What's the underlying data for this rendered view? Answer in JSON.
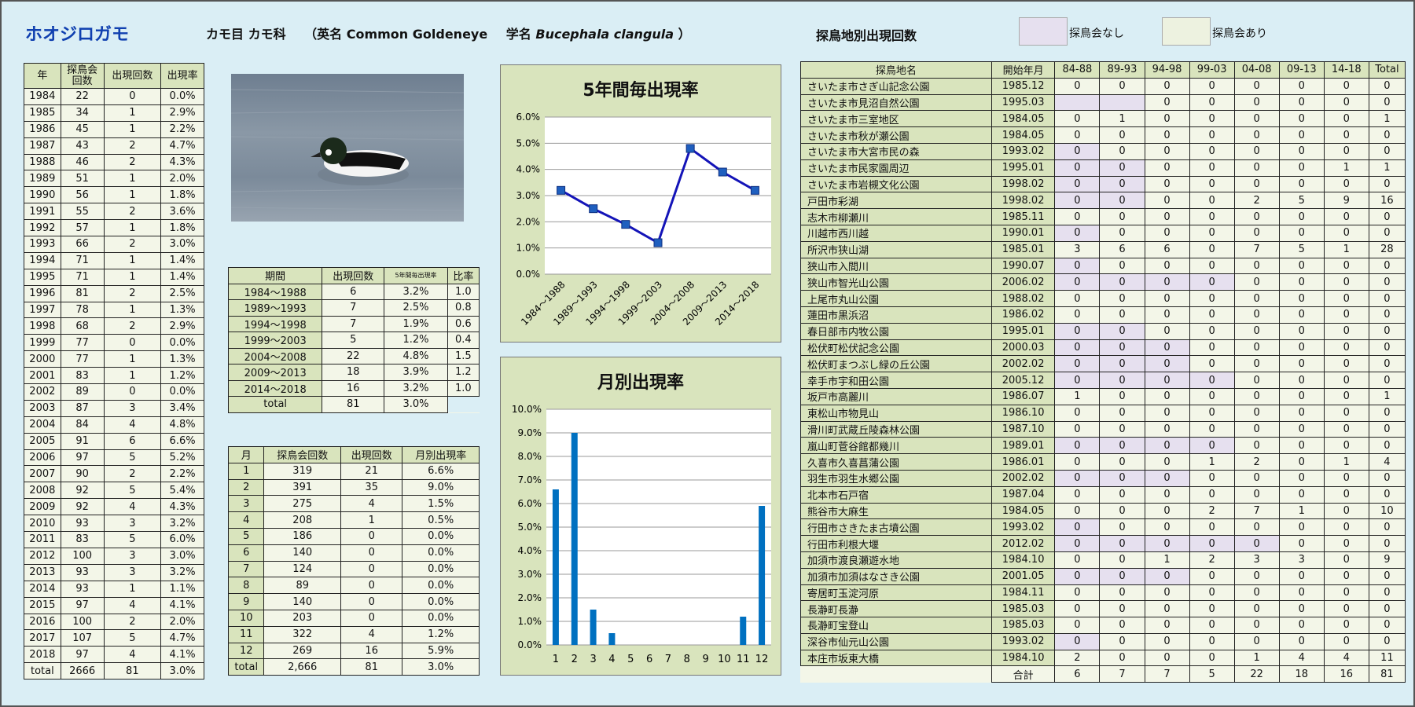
{
  "header": {
    "title": "ホオジロガモ",
    "order_family": "カモ目 カモ科",
    "english_label": "（英名 Common Goldeneye",
    "latin_label": "学名",
    "latin_name": "Bucephala clangula",
    "latin_close": "）",
    "location_title": "探鳥地別出現回数",
    "legend_none": "探鳥会なし",
    "legend_yes": "探鳥会あり"
  },
  "colors": {
    "none_cell": "#e6e0ef",
    "header_cell": "#d9e4bd",
    "series": "#1414b8",
    "bar": "#0070c0"
  },
  "photo": {
    "alt": "ホオジロガモ写真"
  },
  "year_table": {
    "headers": [
      "年",
      "探鳥会\n回数",
      "出現回数",
      "出現率"
    ],
    "rows": [
      [
        "1984",
        "22",
        "0",
        "0.0%"
      ],
      [
        "1985",
        "34",
        "1",
        "2.9%"
      ],
      [
        "1986",
        "45",
        "1",
        "2.2%"
      ],
      [
        "1987",
        "43",
        "2",
        "4.7%"
      ],
      [
        "1988",
        "46",
        "2",
        "4.3%"
      ],
      [
        "1989",
        "51",
        "1",
        "2.0%"
      ],
      [
        "1990",
        "56",
        "1",
        "1.8%"
      ],
      [
        "1991",
        "55",
        "2",
        "3.6%"
      ],
      [
        "1992",
        "57",
        "1",
        "1.8%"
      ],
      [
        "1993",
        "66",
        "2",
        "3.0%"
      ],
      [
        "1994",
        "71",
        "1",
        "1.4%"
      ],
      [
        "1995",
        "71",
        "1",
        "1.4%"
      ],
      [
        "1996",
        "81",
        "2",
        "2.5%"
      ],
      [
        "1997",
        "78",
        "1",
        "1.3%"
      ],
      [
        "1998",
        "68",
        "2",
        "2.9%"
      ],
      [
        "1999",
        "77",
        "0",
        "0.0%"
      ],
      [
        "2000",
        "77",
        "1",
        "1.3%"
      ],
      [
        "2001",
        "83",
        "1",
        "1.2%"
      ],
      [
        "2002",
        "89",
        "0",
        "0.0%"
      ],
      [
        "2003",
        "87",
        "3",
        "3.4%"
      ],
      [
        "2004",
        "84",
        "4",
        "4.8%"
      ],
      [
        "2005",
        "91",
        "6",
        "6.6%"
      ],
      [
        "2006",
        "97",
        "5",
        "5.2%"
      ],
      [
        "2007",
        "90",
        "2",
        "2.2%"
      ],
      [
        "2008",
        "92",
        "5",
        "5.4%"
      ],
      [
        "2009",
        "92",
        "4",
        "4.3%"
      ],
      [
        "2010",
        "93",
        "3",
        "3.2%"
      ],
      [
        "2011",
        "83",
        "5",
        "6.0%"
      ],
      [
        "2012",
        "100",
        "3",
        "3.0%"
      ],
      [
        "2013",
        "93",
        "3",
        "3.2%"
      ],
      [
        "2014",
        "93",
        "1",
        "1.1%"
      ],
      [
        "2015",
        "97",
        "4",
        "4.1%"
      ],
      [
        "2016",
        "100",
        "2",
        "2.0%"
      ],
      [
        "2017",
        "107",
        "5",
        "4.7%"
      ],
      [
        "2018",
        "97",
        "4",
        "4.1%"
      ],
      [
        "total",
        "2666",
        "81",
        "3.0%"
      ]
    ]
  },
  "period_table": {
    "headers": [
      "期間",
      "出現回数",
      "5年間毎出現率",
      "比率"
    ],
    "rows": [
      [
        "1984～1988",
        "6",
        "3.2%",
        "1.0"
      ],
      [
        "1989～1993",
        "7",
        "2.5%",
        "0.8"
      ],
      [
        "1994～1998",
        "7",
        "1.9%",
        "0.6"
      ],
      [
        "1999～2003",
        "5",
        "1.2%",
        "0.4"
      ],
      [
        "2004～2008",
        "22",
        "4.8%",
        "1.5"
      ],
      [
        "2009～2013",
        "18",
        "3.9%",
        "1.2"
      ],
      [
        "2014～2018",
        "16",
        "3.2%",
        "1.0"
      ]
    ],
    "total": [
      "total",
      "81",
      "3.0%"
    ]
  },
  "month_table": {
    "headers": [
      "月",
      "探鳥会回数",
      "出現回数",
      "月別出現率"
    ],
    "rows": [
      [
        "1",
        "319",
        "21",
        "6.6%"
      ],
      [
        "2",
        "391",
        "35",
        "9.0%"
      ],
      [
        "3",
        "275",
        "4",
        "1.5%"
      ],
      [
        "4",
        "208",
        "1",
        "0.5%"
      ],
      [
        "5",
        "186",
        "0",
        "0.0%"
      ],
      [
        "6",
        "140",
        "0",
        "0.0%"
      ],
      [
        "7",
        "124",
        "0",
        "0.0%"
      ],
      [
        "8",
        "89",
        "0",
        "0.0%"
      ],
      [
        "9",
        "140",
        "0",
        "0.0%"
      ],
      [
        "10",
        "203",
        "0",
        "0.0%"
      ],
      [
        "11",
        "322",
        "4",
        "1.2%"
      ],
      [
        "12",
        "269",
        "16",
        "5.9%"
      ],
      [
        "total",
        "2,666",
        "81",
        "3.0%"
      ]
    ]
  },
  "chart_data": [
    {
      "type": "line",
      "title": "5年間毎出現率",
      "categories": [
        "1984～1988",
        "1989～1993",
        "1994～1998",
        "1999～2003",
        "2004～2008",
        "2009～2013",
        "2014～2018"
      ],
      "values": [
        3.2,
        2.5,
        1.9,
        1.2,
        4.8,
        3.9,
        3.2
      ],
      "ylim": [
        0,
        6
      ],
      "yticks": [
        "0.0%",
        "1.0%",
        "2.0%",
        "3.0%",
        "4.0%",
        "5.0%",
        "6.0%"
      ],
      "grid": true
    },
    {
      "type": "bar",
      "title": "月別出現率",
      "categories": [
        "1",
        "2",
        "3",
        "4",
        "5",
        "6",
        "7",
        "8",
        "9",
        "10",
        "11",
        "12"
      ],
      "values": [
        6.6,
        9.0,
        1.5,
        0.5,
        0.0,
        0.0,
        0.0,
        0.0,
        0.0,
        0.0,
        1.2,
        5.9
      ],
      "ylim": [
        0,
        10
      ],
      "yticks": [
        "0.0%",
        "1.0%",
        "2.0%",
        "3.0%",
        "4.0%",
        "5.0%",
        "6.0%",
        "7.0%",
        "8.0%",
        "9.0%",
        "10.0%"
      ],
      "grid": true
    }
  ],
  "location_table": {
    "headers": [
      "探鳥地名",
      "開始年月",
      "84-88",
      "89-93",
      "94-98",
      "99-03",
      "04-08",
      "09-13",
      "14-18",
      "Total"
    ],
    "rows": [
      {
        "name": "さいたま市さぎ山記念公園",
        "start": "1985.12",
        "v": [
          "0",
          "0",
          "0",
          "0",
          "0",
          "0",
          "0",
          "0"
        ],
        "none": []
      },
      {
        "name": "さいたま市見沼自然公園",
        "start": "1995.03",
        "v": [
          "",
          "",
          "0",
          "0",
          "0",
          "0",
          "0",
          "0"
        ],
        "none": [
          0,
          1
        ]
      },
      {
        "name": "さいたま市三室地区",
        "start": "1984.05",
        "v": [
          "0",
          "1",
          "0",
          "0",
          "0",
          "0",
          "0",
          "1"
        ],
        "none": []
      },
      {
        "name": "さいたま市秋が瀬公園",
        "start": "1984.05",
        "v": [
          "0",
          "0",
          "0",
          "0",
          "0",
          "0",
          "0",
          "0"
        ],
        "none": []
      },
      {
        "name": "さいたま市大宮市民の森",
        "start": "1993.02",
        "v": [
          "0",
          "0",
          "0",
          "0",
          "0",
          "0",
          "0",
          "0"
        ],
        "none": [
          0
        ]
      },
      {
        "name": "さいたま市民家園周辺",
        "start": "1995.01",
        "v": [
          "0",
          "0",
          "0",
          "0",
          "0",
          "0",
          "1",
          "1"
        ],
        "none": [
          0,
          1
        ]
      },
      {
        "name": "さいたま市岩槻文化公園",
        "start": "1998.02",
        "v": [
          "0",
          "0",
          "0",
          "0",
          "0",
          "0",
          "0",
          "0"
        ],
        "none": [
          0,
          1
        ]
      },
      {
        "name": "戸田市彩湖",
        "start": "1998.02",
        "v": [
          "0",
          "0",
          "0",
          "0",
          "2",
          "5",
          "9",
          "16"
        ],
        "none": [
          0,
          1
        ]
      },
      {
        "name": "志木市柳瀬川",
        "start": "1985.11",
        "v": [
          "0",
          "0",
          "0",
          "0",
          "0",
          "0",
          "0",
          "0"
        ],
        "none": []
      },
      {
        "name": "川越市西川越",
        "start": "1990.01",
        "v": [
          "0",
          "0",
          "0",
          "0",
          "0",
          "0",
          "0",
          "0"
        ],
        "none": [
          0
        ]
      },
      {
        "name": "所沢市狭山湖",
        "start": "1985.01",
        "v": [
          "3",
          "6",
          "6",
          "0",
          "7",
          "5",
          "1",
          "28"
        ],
        "none": []
      },
      {
        "name": "狭山市入間川",
        "start": "1990.07",
        "v": [
          "0",
          "0",
          "0",
          "0",
          "0",
          "0",
          "0",
          "0"
        ],
        "none": [
          0
        ]
      },
      {
        "name": "狭山市智光山公園",
        "start": "2006.02",
        "v": [
          "0",
          "0",
          "0",
          "0",
          "0",
          "0",
          "0",
          "0"
        ],
        "none": [
          0,
          1,
          2,
          3
        ]
      },
      {
        "name": "上尾市丸山公園",
        "start": "1988.02",
        "v": [
          "0",
          "0",
          "0",
          "0",
          "0",
          "0",
          "0",
          "0"
        ],
        "none": []
      },
      {
        "name": "蓮田市黒浜沼",
        "start": "1986.02",
        "v": [
          "0",
          "0",
          "0",
          "0",
          "0",
          "0",
          "0",
          "0"
        ],
        "none": []
      },
      {
        "name": "春日部市内牧公園",
        "start": "1995.01",
        "v": [
          "0",
          "0",
          "0",
          "0",
          "0",
          "0",
          "0",
          "0"
        ],
        "none": [
          0,
          1
        ]
      },
      {
        "name": "松伏町松伏記念公園",
        "start": "2000.03",
        "v": [
          "0",
          "0",
          "0",
          "0",
          "0",
          "0",
          "0",
          "0"
        ],
        "none": [
          0,
          1,
          2
        ]
      },
      {
        "name": "松伏町まつぶし緑の丘公園",
        "start": "2002.02",
        "v": [
          "0",
          "0",
          "0",
          "0",
          "0",
          "0",
          "0",
          "0"
        ],
        "none": [
          0,
          1,
          2
        ]
      },
      {
        "name": "幸手市宇和田公園",
        "start": "2005.12",
        "v": [
          "0",
          "0",
          "0",
          "0",
          "0",
          "0",
          "0",
          "0"
        ],
        "none": [
          0,
          1,
          2,
          3
        ]
      },
      {
        "name": "坂戸市高麗川",
        "start": "1986.07",
        "v": [
          "1",
          "0",
          "0",
          "0",
          "0",
          "0",
          "0",
          "1"
        ],
        "none": []
      },
      {
        "name": "東松山市物見山",
        "start": "1986.10",
        "v": [
          "0",
          "0",
          "0",
          "0",
          "0",
          "0",
          "0",
          "0"
        ],
        "none": []
      },
      {
        "name": "滑川町武蔵丘陵森林公園",
        "start": "1987.10",
        "v": [
          "0",
          "0",
          "0",
          "0",
          "0",
          "0",
          "0",
          "0"
        ],
        "none": []
      },
      {
        "name": "嵐山町菅谷館都幾川",
        "start": "1989.01",
        "v": [
          "0",
          "0",
          "0",
          "0",
          "0",
          "0",
          "0",
          "0"
        ],
        "none": [
          0,
          1,
          2,
          3
        ]
      },
      {
        "name": "久喜市久喜菖蒲公園",
        "start": "1986.01",
        "v": [
          "0",
          "0",
          "0",
          "1",
          "2",
          "0",
          "1",
          "4"
        ],
        "none": []
      },
      {
        "name": "羽生市羽生水郷公園",
        "start": "2002.02",
        "v": [
          "0",
          "0",
          "0",
          "0",
          "0",
          "0",
          "0",
          "0"
        ],
        "none": [
          0,
          1,
          2
        ]
      },
      {
        "name": "北本市石戸宿",
        "start": "1987.04",
        "v": [
          "0",
          "0",
          "0",
          "0",
          "0",
          "0",
          "0",
          "0"
        ],
        "none": []
      },
      {
        "name": "熊谷市大麻生",
        "start": "1984.05",
        "v": [
          "0",
          "0",
          "0",
          "2",
          "7",
          "1",
          "0",
          "10"
        ],
        "none": []
      },
      {
        "name": "行田市さきたま古墳公園",
        "start": "1993.02",
        "v": [
          "0",
          "0",
          "0",
          "0",
          "0",
          "0",
          "0",
          "0"
        ],
        "none": [
          0
        ]
      },
      {
        "name": "行田市利根大堰",
        "start": "2012.02",
        "v": [
          "0",
          "0",
          "0",
          "0",
          "0",
          "0",
          "0",
          "0"
        ],
        "none": [
          0,
          1,
          2,
          3,
          4
        ]
      },
      {
        "name": "加須市渡良瀬遊水地",
        "start": "1984.10",
        "v": [
          "0",
          "0",
          "1",
          "2",
          "3",
          "3",
          "0",
          "9"
        ],
        "none": []
      },
      {
        "name": "加須市加須はなさき公園",
        "start": "2001.05",
        "v": [
          "0",
          "0",
          "0",
          "0",
          "0",
          "0",
          "0",
          "0"
        ],
        "none": [
          0,
          1,
          2
        ]
      },
      {
        "name": "寄居町玉淀河原",
        "start": "1984.11",
        "v": [
          "0",
          "0",
          "0",
          "0",
          "0",
          "0",
          "0",
          "0"
        ],
        "none": []
      },
      {
        "name": "長瀞町長瀞",
        "start": "1985.03",
        "v": [
          "0",
          "0",
          "0",
          "0",
          "0",
          "0",
          "0",
          "0"
        ],
        "none": []
      },
      {
        "name": "長瀞町宝登山",
        "start": "1985.03",
        "v": [
          "0",
          "0",
          "0",
          "0",
          "0",
          "0",
          "0",
          "0"
        ],
        "none": []
      },
      {
        "name": "深谷市仙元山公園",
        "start": "1993.02",
        "v": [
          "0",
          "0",
          "0",
          "0",
          "0",
          "0",
          "0",
          "0"
        ],
        "none": [
          0
        ]
      },
      {
        "name": "本庄市坂東大橋",
        "start": "1984.10",
        "v": [
          "2",
          "0",
          "0",
          "0",
          "1",
          "4",
          "4",
          "11"
        ],
        "none": []
      }
    ],
    "sum_label": "合計",
    "sums": [
      "6",
      "7",
      "7",
      "5",
      "22",
      "18",
      "16",
      "81"
    ]
  }
}
